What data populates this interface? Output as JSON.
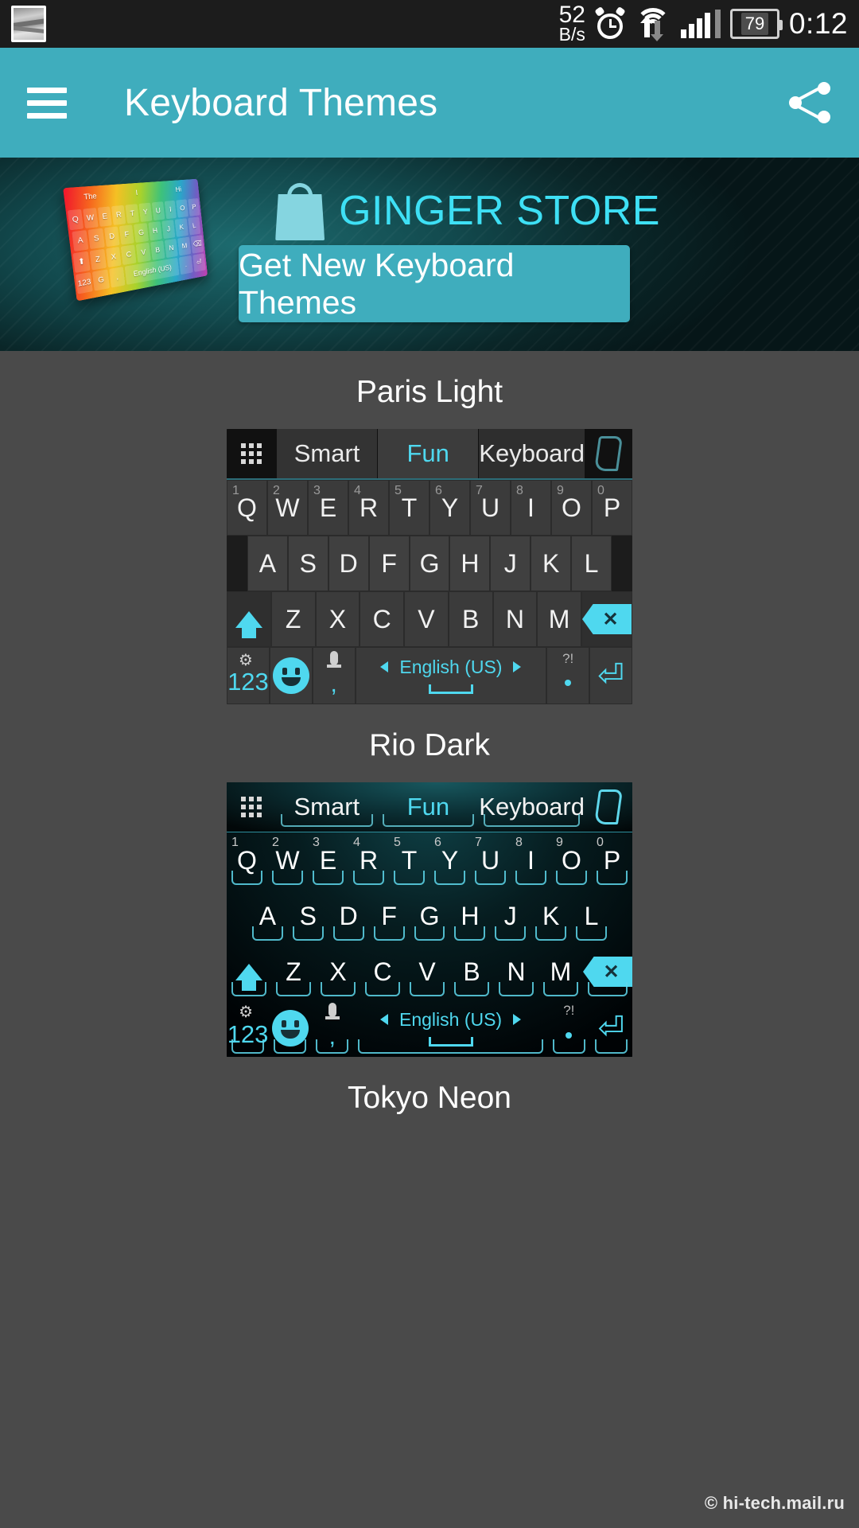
{
  "status_bar": {
    "network_speed_value": "52",
    "network_speed_unit": "B/s",
    "battery_percent": "79",
    "clock": "0:12",
    "icons": [
      "photo-icon",
      "alarm-icon",
      "wifi-icon",
      "signal-icon",
      "battery-icon"
    ]
  },
  "app_bar": {
    "menu_icon": "hamburger-menu-icon",
    "title": "Keyboard Themes",
    "share_icon": "share-icon",
    "background_color": "#3fadbd"
  },
  "banner": {
    "store_title": "GINGER STORE",
    "store_icon": "shopping-bag-icon",
    "cta_label": "Get New Keyboard Themes",
    "cta_color": "#3fadbd",
    "title_color": "#3ee0f5",
    "preview_suggestions": [
      "The",
      "I",
      "Hi"
    ]
  },
  "keyboard_common": {
    "suggestions": [
      "Smart",
      "Fun",
      "Keyboard"
    ],
    "active_suggestion": "Fun",
    "grid_icon": "apps-grid-icon",
    "pen_icon": "pen-icon",
    "row1": [
      "Q",
      "W",
      "E",
      "R",
      "T",
      "Y",
      "U",
      "I",
      "O",
      "P"
    ],
    "row1_numbers": [
      "1",
      "2",
      "3",
      "4",
      "5",
      "6",
      "7",
      "8",
      "9",
      "0"
    ],
    "row2": [
      "A",
      "S",
      "D",
      "F",
      "G",
      "H",
      "J",
      "K",
      "L"
    ],
    "row3": [
      "Z",
      "X",
      "C",
      "V",
      "B",
      "N",
      "M"
    ],
    "shift_icon": "shift-arrow-icon",
    "backspace_icon": "backspace-icon",
    "numeric_label": "123",
    "gear_icon": "gear-icon",
    "emoji_icon": "emoji-smiley-icon",
    "mic_icon": "microphone-icon",
    "comma_label": ",",
    "language_label": "English (US)",
    "space_icon": "spacebar-icon",
    "punct_label": "?!",
    "period_label": ".",
    "enter_icon": "enter-return-icon",
    "accent_color": "#4fd8ef"
  },
  "themes": [
    {
      "name": "Paris Light",
      "style": "paris"
    },
    {
      "name": "Rio Dark",
      "style": "rio"
    },
    {
      "name": "Tokyo Neon",
      "style": "tokyo"
    }
  ],
  "footer": {
    "watermark": "© hi-tech.mail.ru"
  }
}
